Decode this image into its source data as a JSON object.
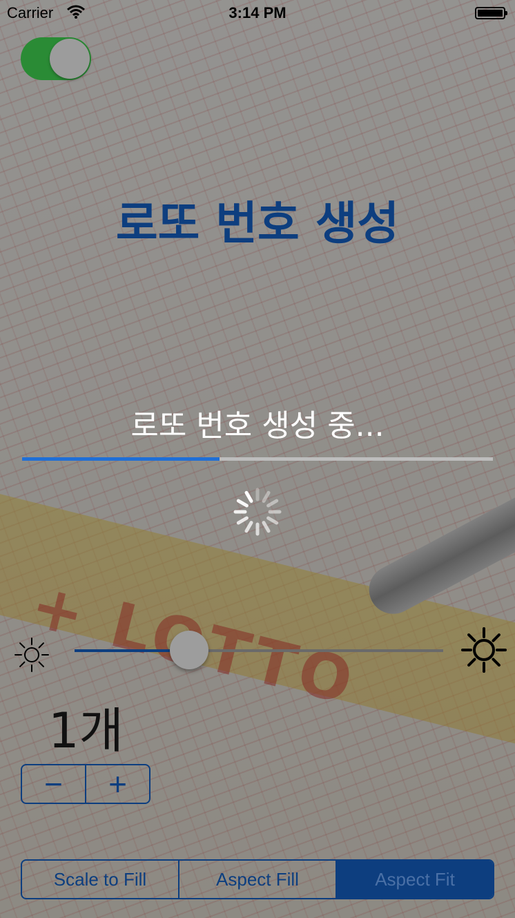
{
  "status_bar": {
    "carrier": "Carrier",
    "time": "3:14 PM",
    "icons": [
      "wifi-icon",
      "battery-icon"
    ]
  },
  "toggle": {
    "on": true,
    "color": "#2a8b35"
  },
  "title": "로또 번호 생성",
  "loading": {
    "text": "로또 번호 생성 중...",
    "progress": 0.42
  },
  "brightness": {
    "value": 0.31,
    "min_icon": "sun-small-icon",
    "max_icon": "sun-large-icon"
  },
  "counter": {
    "label": "1개",
    "minus": "−",
    "plus": "+"
  },
  "content_mode": {
    "options": [
      "Scale to Fill",
      "Aspect Fill",
      "Aspect Fit"
    ],
    "selected_index": 2
  },
  "colors": {
    "accent": "#0d3e7f",
    "progress": "#1f6fd6"
  }
}
